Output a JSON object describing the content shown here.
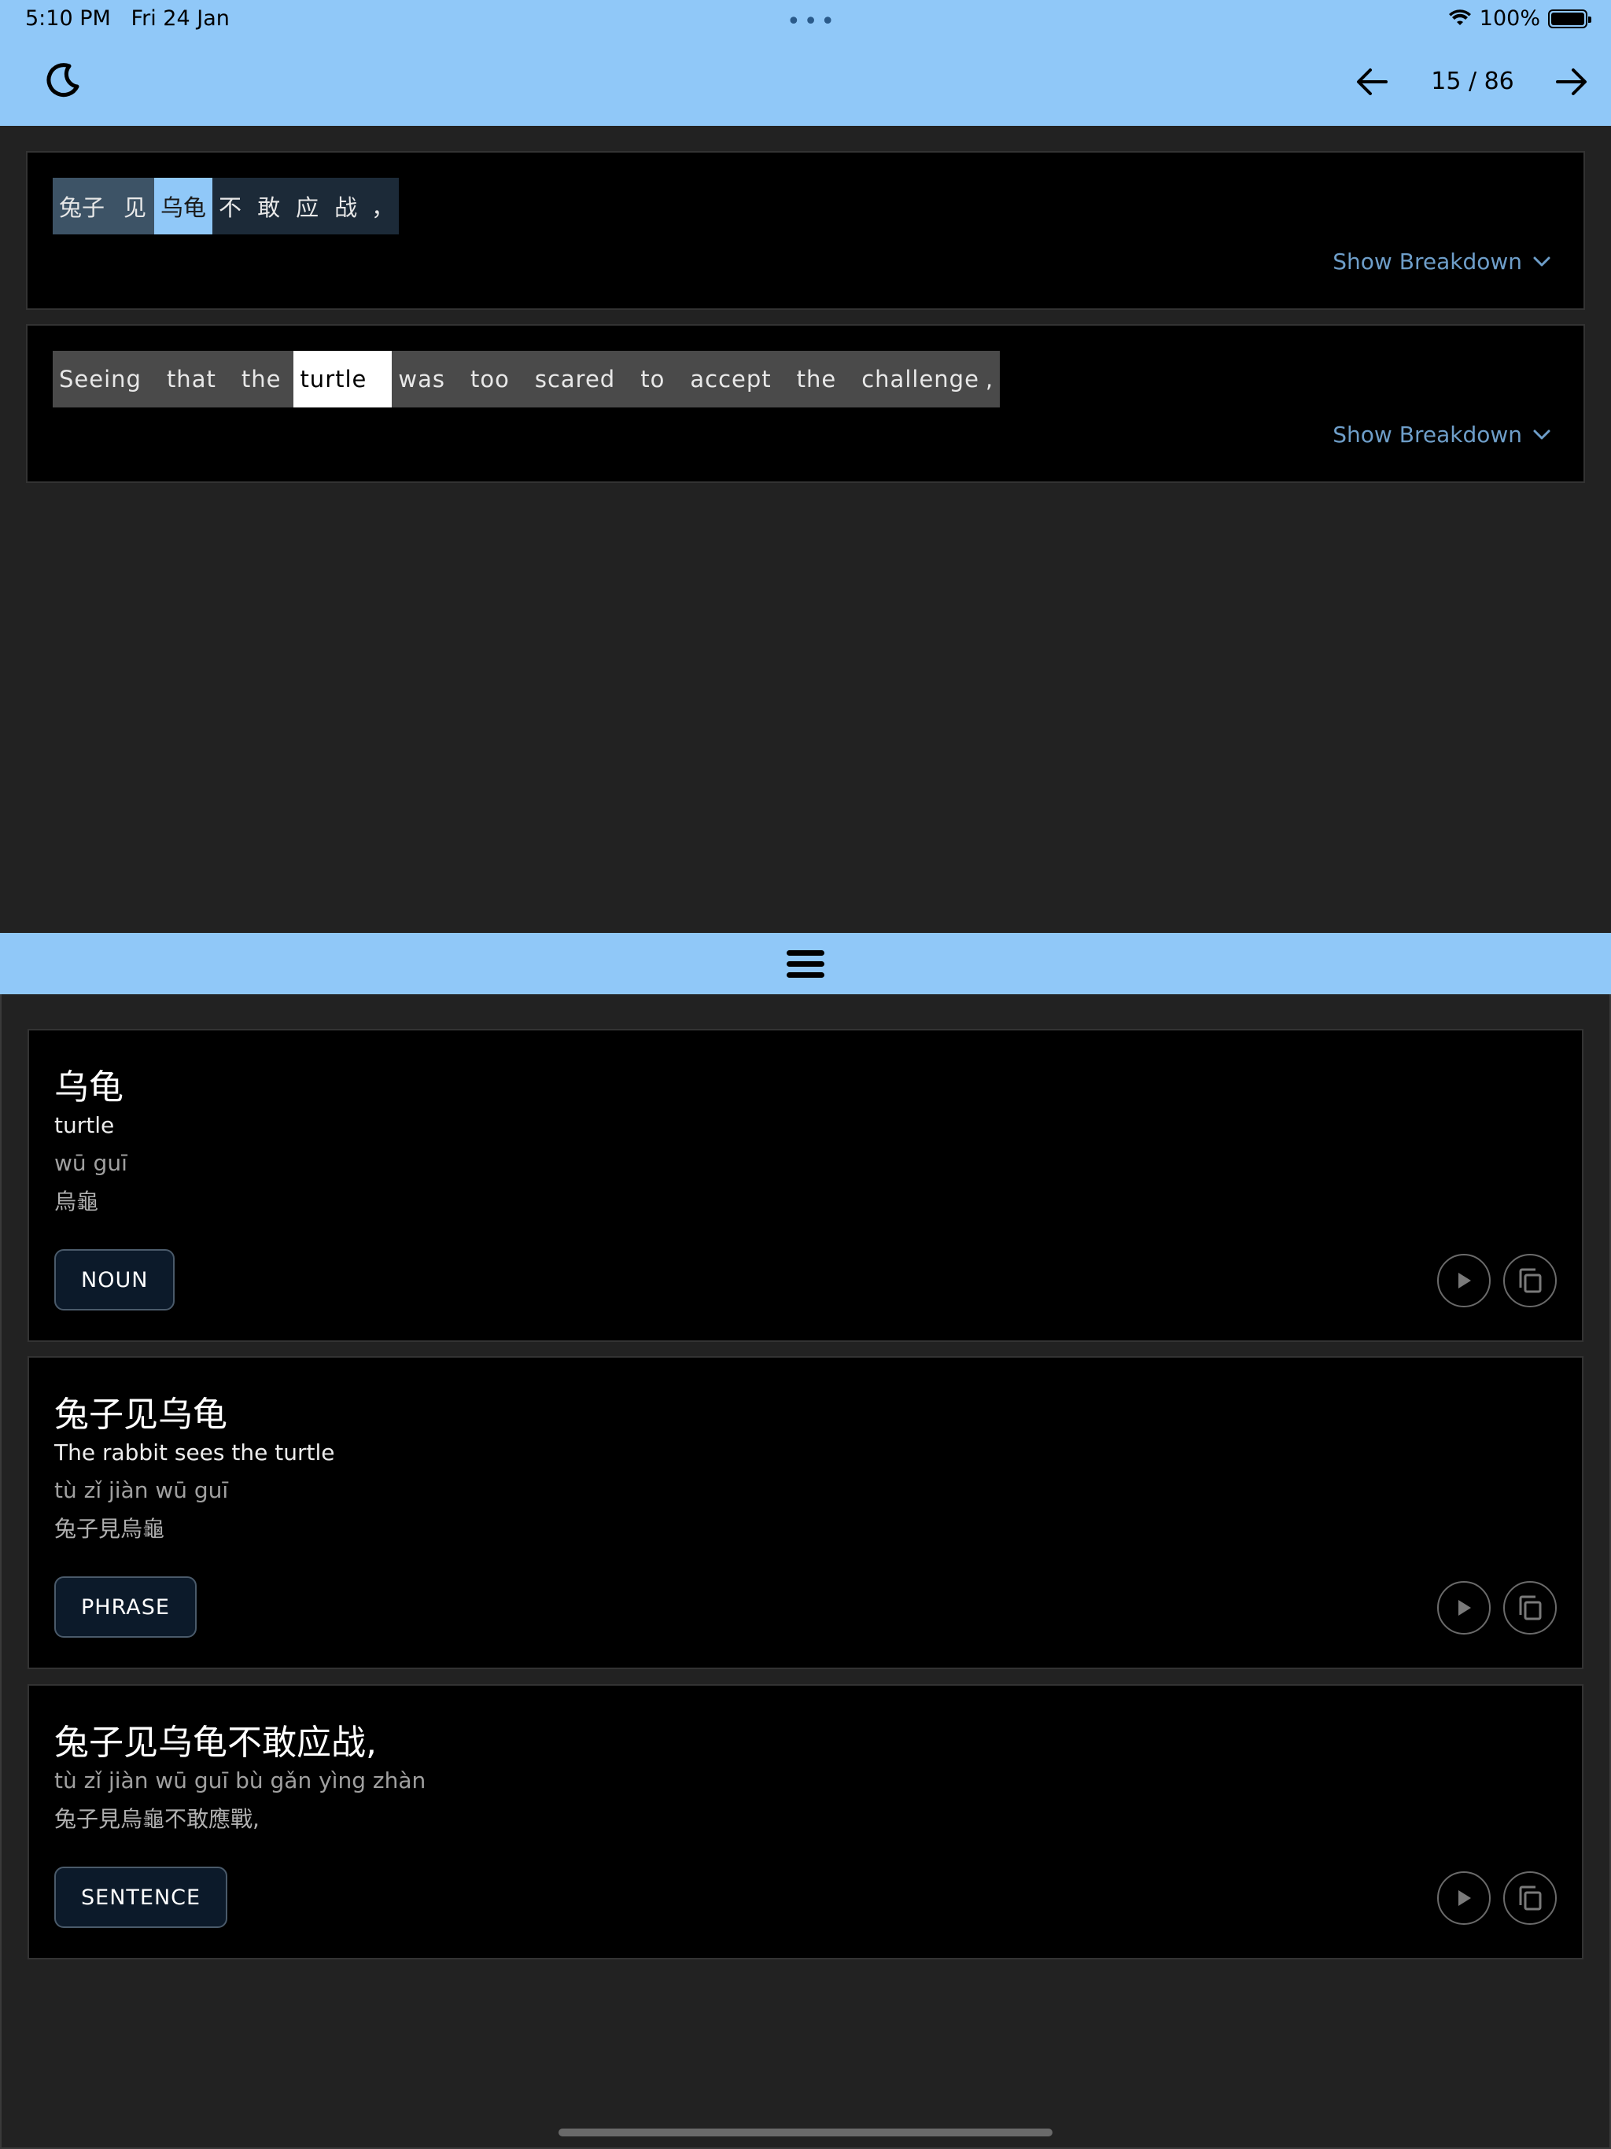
{
  "status_bar": {
    "time": "5:10 PM",
    "date": "Fri 24 Jan",
    "battery": "100%"
  },
  "header": {
    "page_counter": "15 / 86",
    "icons": {
      "theme": "moon-icon",
      "prev": "arrow-left-icon",
      "next": "arrow-right-icon"
    }
  },
  "sentence": {
    "chinese_tokens": [
      {
        "text": "兔子",
        "group": "subject"
      },
      {
        "text": "见",
        "group": "subject"
      },
      {
        "text": "乌龟",
        "group": "selected"
      },
      {
        "text": "不",
        "group": "rest"
      },
      {
        "text": "敢",
        "group": "rest"
      },
      {
        "text": "应",
        "group": "rest"
      },
      {
        "text": "战",
        "group": "rest"
      },
      {
        "text": "，",
        "group": "rest"
      }
    ],
    "english_tokens": [
      {
        "text": "Seeing"
      },
      {
        "text": "that"
      },
      {
        "text": "the"
      },
      {
        "text": "turtle",
        "selected": true
      },
      {
        "text": "was"
      },
      {
        "text": "too"
      },
      {
        "text": "scared"
      },
      {
        "text": "to"
      },
      {
        "text": "accept"
      },
      {
        "text": "the"
      },
      {
        "text": "challenge"
      },
      {
        "text": ","
      }
    ],
    "show_breakdown_label": "Show Breakdown"
  },
  "entries": [
    {
      "title": "乌龟",
      "meaning": "turtle",
      "pinyin": "wū guī",
      "traditional": "烏龜",
      "tag": "NOUN"
    },
    {
      "title": "兔子见乌龟",
      "meaning": "The rabbit sees the turtle",
      "pinyin": "tù zǐ jiàn wū guī",
      "traditional": "兔子見烏龜",
      "tag": "PHRASE"
    },
    {
      "title": "兔子见乌龟不敢应战,",
      "meaning": "",
      "pinyin": "tù zǐ jiàn wū guī bù gǎn yìng zhàn",
      "traditional": "兔子見烏龜不敢應戰,",
      "tag": "SENTENCE"
    }
  ],
  "colors": {
    "accent": "#90c8f8",
    "background": "#222222",
    "card": "#000000",
    "link": "#6e9ec9"
  }
}
